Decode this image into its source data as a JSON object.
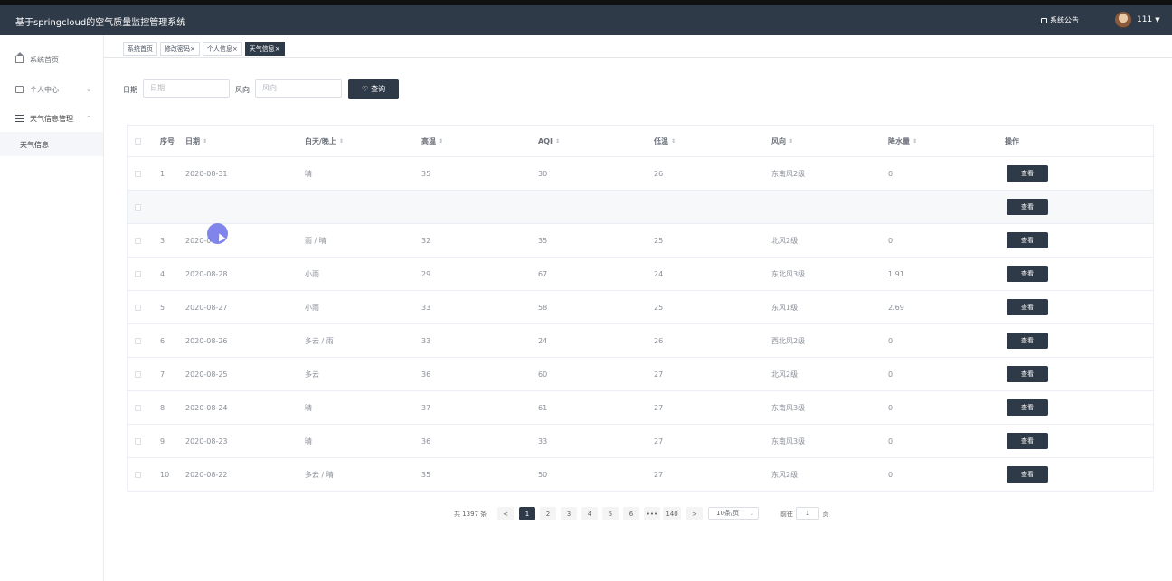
{
  "header": {
    "title": "基于springcloud的空气质量监控管理系统",
    "notice": "系统公告",
    "username": "111"
  },
  "sidebar": {
    "items": [
      {
        "label": "系统首页"
      },
      {
        "label": "个人中心"
      },
      {
        "label": "天气信息管理"
      }
    ],
    "sub_item": "天气信息"
  },
  "tabs": [
    {
      "label": "系统首页"
    },
    {
      "label": "修改密码×"
    },
    {
      "label": "个人信息×"
    },
    {
      "label": "天气信息×"
    }
  ],
  "search": {
    "date_label": "日期",
    "date_placeholder": "日期",
    "wind_label": "风向",
    "wind_placeholder": "风向",
    "query_button": "查询"
  },
  "table": {
    "columns": [
      "序号",
      "日期",
      "白天/晚上",
      "高温",
      "AQI",
      "低温",
      "风向",
      "降水量",
      "操作"
    ],
    "action_label": "查看",
    "rows": [
      {
        "no": "1",
        "date": "2020-08-31",
        "day_night": "晴",
        "high": "35",
        "aqi": "30",
        "low": "26",
        "wind": "东南风2级",
        "rain": "0"
      },
      {
        "no": "",
        "date": "",
        "day_night": "",
        "high": "",
        "aqi": "",
        "low": "",
        "wind": "",
        "rain": ""
      },
      {
        "no": "3",
        "date": "2020-0",
        "day_night": "雨 / 晴",
        "high": "32",
        "aqi": "35",
        "low": "25",
        "wind": "北风2级",
        "rain": "0"
      },
      {
        "no": "4",
        "date": "2020-08-28",
        "day_night": "小雨",
        "high": "29",
        "aqi": "67",
        "low": "24",
        "wind": "东北风3级",
        "rain": "1.91"
      },
      {
        "no": "5",
        "date": "2020-08-27",
        "day_night": "小雨",
        "high": "33",
        "aqi": "58",
        "low": "25",
        "wind": "东风1级",
        "rain": "2.69"
      },
      {
        "no": "6",
        "date": "2020-08-26",
        "day_night": "多云 / 雨",
        "high": "33",
        "aqi": "24",
        "low": "26",
        "wind": "西北风2级",
        "rain": "0"
      },
      {
        "no": "7",
        "date": "2020-08-25",
        "day_night": "多云",
        "high": "36",
        "aqi": "60",
        "low": "27",
        "wind": "北风2级",
        "rain": "0"
      },
      {
        "no": "8",
        "date": "2020-08-24",
        "day_night": "晴",
        "high": "37",
        "aqi": "61",
        "low": "27",
        "wind": "东南风3级",
        "rain": "0"
      },
      {
        "no": "9",
        "date": "2020-08-23",
        "day_night": "晴",
        "high": "36",
        "aqi": "33",
        "low": "27",
        "wind": "东南风3级",
        "rain": "0"
      },
      {
        "no": "10",
        "date": "2020-08-22",
        "day_night": "多云 / 晴",
        "high": "35",
        "aqi": "50",
        "low": "27",
        "wind": "东风2级",
        "rain": "0"
      }
    ]
  },
  "pagination": {
    "total_text": "共 1397 条",
    "prev": "<",
    "pages": [
      "1",
      "2",
      "3",
      "4",
      "5",
      "6"
    ],
    "ellipsis": "•••",
    "last_page": "140",
    "next": ">",
    "page_size": "10条/页",
    "goto_label": "前往",
    "goto_value": "1",
    "page_unit": "页"
  },
  "colors": {
    "header_bg": "#2f3a48",
    "accent": "#2f3a48"
  }
}
